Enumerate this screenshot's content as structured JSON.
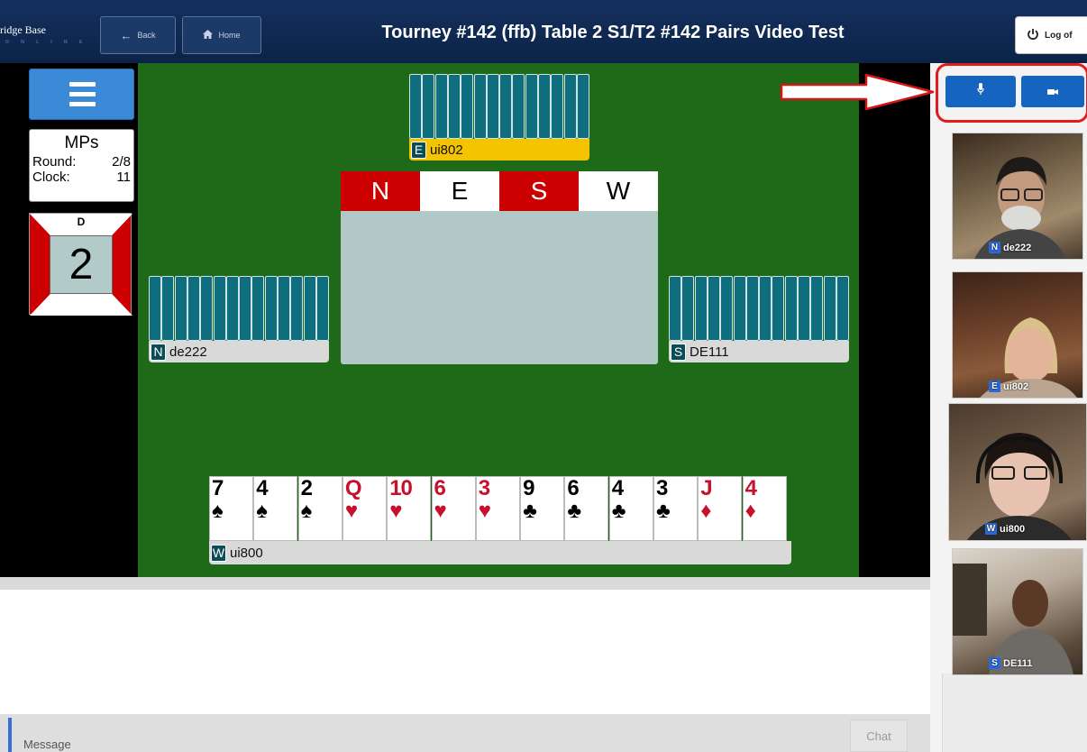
{
  "topbar": {
    "brand": "ridge Base",
    "brand_sub": "O N L I N E",
    "back_label": "Back",
    "home_label": "Home",
    "title": "Tourney #142 (ffb) Table 2 S1/T2 #142 Pairs Video Test",
    "logoff_label": "Log of"
  },
  "scoring": {
    "type": "MPs",
    "round_label": "Round:",
    "round_value": "2/8",
    "clock_label": "Clock:",
    "clock_value": "11"
  },
  "board": {
    "dealer": "D",
    "number": "2"
  },
  "seats": {
    "top": {
      "dir": "E",
      "name": "ui802"
    },
    "left": {
      "dir": "N",
      "name": "de222"
    },
    "right": {
      "dir": "S",
      "name": "DE111"
    },
    "bottom": {
      "dir": "W",
      "name": "ui800"
    }
  },
  "compass": {
    "n": "N",
    "e": "E",
    "s": "S",
    "w": "W"
  },
  "hand": [
    {
      "rank": "7",
      "suit": "♠",
      "color": "black"
    },
    {
      "rank": "4",
      "suit": "♠",
      "color": "black"
    },
    {
      "rank": "2",
      "suit": "♠",
      "color": "black"
    },
    {
      "rank": "Q",
      "suit": "♥",
      "color": "red"
    },
    {
      "rank": "10",
      "suit": "♥",
      "color": "red"
    },
    {
      "rank": "6",
      "suit": "♥",
      "color": "red"
    },
    {
      "rank": "3",
      "suit": "♥",
      "color": "red"
    },
    {
      "rank": "9",
      "suit": "♣",
      "color": "black"
    },
    {
      "rank": "6",
      "suit": "♣",
      "color": "black"
    },
    {
      "rank": "4",
      "suit": "♣",
      "color": "black"
    },
    {
      "rank": "3",
      "suit": "♣",
      "color": "black"
    },
    {
      "rank": "J",
      "suit": "♦",
      "color": "red"
    },
    {
      "rank": "4",
      "suit": "♦",
      "color": "red"
    }
  ],
  "chat": {
    "message_placeholder": "Message",
    "send_label": "Chat"
  },
  "videos": [
    {
      "dir": "N",
      "name": "de222"
    },
    {
      "dir": "E",
      "name": "ui802"
    },
    {
      "dir": "W",
      "name": "ui800"
    },
    {
      "dir": "S",
      "name": "DE111"
    }
  ],
  "colors": {
    "table_green": "#1e6a19",
    "card_back": "#0f6e7e",
    "turn_highlight": "#f5c400",
    "accent_blue": "#1565c0",
    "highlight_red": "#e21b1b"
  }
}
